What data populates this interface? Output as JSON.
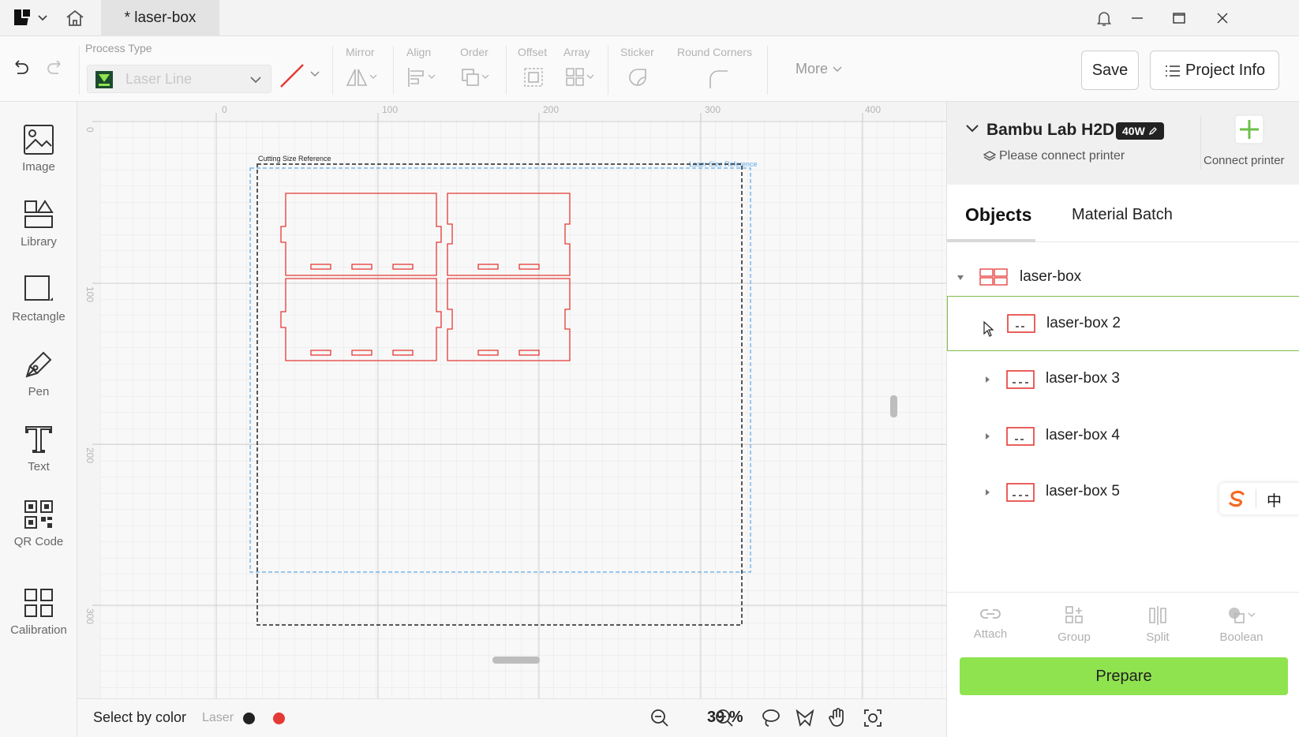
{
  "titlebar": {
    "tab_title": "* laser-box"
  },
  "toolbar": {
    "process_type_label": "Process Type",
    "process_type_value": "Laser Line",
    "groups": {
      "mirror": "Mirror",
      "align": "Align",
      "order": "Order",
      "offset": "Offset",
      "array": "Array",
      "sticker": "Sticker",
      "round_corners": "Round Corners"
    },
    "more_label": "More",
    "save_label": "Save",
    "project_info_label": "Project Info"
  },
  "left_tools": [
    {
      "label": "Image",
      "icon": "image-icon"
    },
    {
      "label": "Library",
      "icon": "library-icon"
    },
    {
      "label": "Rectangle",
      "icon": "rectangle-icon"
    },
    {
      "label": "Pen",
      "icon": "pen-icon"
    },
    {
      "label": "Text",
      "icon": "text-icon"
    },
    {
      "label": "QR Code",
      "icon": "qr-code-icon"
    },
    {
      "label": "Calibration",
      "icon": "calibration-icon"
    }
  ],
  "canvas": {
    "ruler_top": [
      "0",
      "100",
      "200",
      "300",
      "400"
    ],
    "ruler_left": [
      "0",
      "100",
      "200",
      "300"
    ],
    "cutting_size_label": "Cutting Size Reference",
    "laser_size_label": "Laser Size Reference",
    "cut_color": "#e53935",
    "laser_ref_color": "#5aa7e6"
  },
  "statusbar": {
    "select_by_color": "Select by color",
    "laser_label": "Laser",
    "swatches": [
      "#222222",
      "#e53935"
    ],
    "zoom": "39 %"
  },
  "printer": {
    "name": "Bambu Lab H2D",
    "badge": "40W",
    "status": "Please connect printer",
    "connect_label": "Connect printer"
  },
  "tabs": {
    "objects": "Objects",
    "material_batch": "Material Batch"
  },
  "objects": {
    "root": "laser-box",
    "children": [
      "laser-box 2",
      "laser-box 3",
      "laser-box 4",
      "laser-box 5"
    ]
  },
  "ime": {
    "char": "中"
  },
  "actions": {
    "attach": "Attach",
    "group": "Group",
    "split": "Split",
    "boolean": "Boolean",
    "prepare": "Prepare"
  },
  "colors": {
    "accent_green": "#8fe34f",
    "selection_green": "#7ec04a"
  }
}
